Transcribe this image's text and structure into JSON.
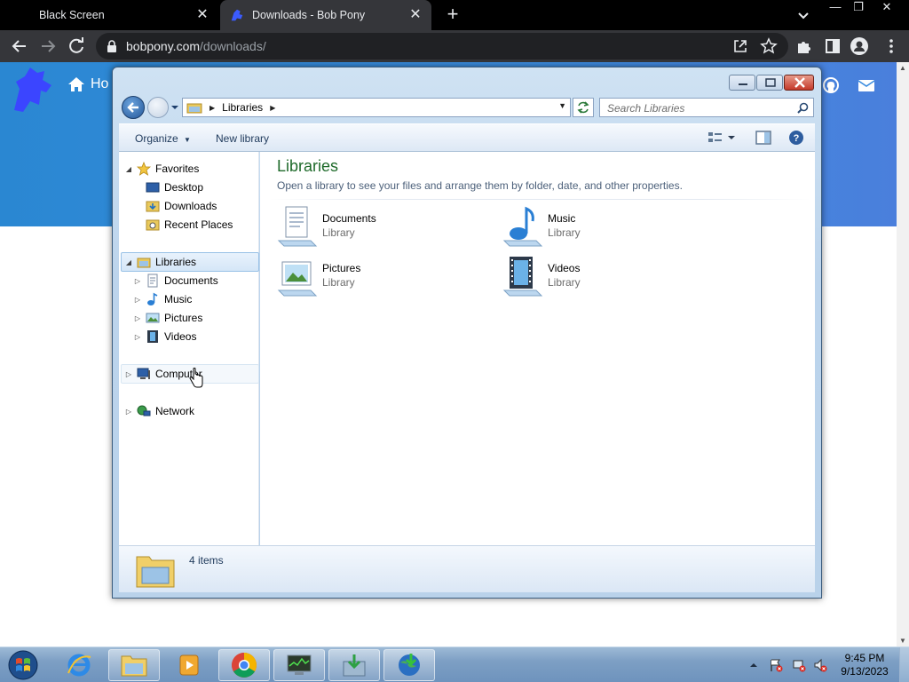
{
  "browser": {
    "tabs": [
      {
        "title": "Black Screen",
        "active": false
      },
      {
        "title": "Downloads - Bob Pony",
        "active": true
      }
    ],
    "url": {
      "host": "bobpony.com",
      "path": "/downloads/"
    }
  },
  "website": {
    "nav_home_label": "Ho"
  },
  "explorer": {
    "address": {
      "root": "Libraries"
    },
    "search_placeholder": "Search Libraries",
    "commands": {
      "organize": "Organize",
      "new_library": "New library"
    },
    "nav": {
      "favorites": {
        "label": "Favorites",
        "items": [
          "Desktop",
          "Downloads",
          "Recent Places"
        ]
      },
      "libraries": {
        "label": "Libraries",
        "items": [
          "Documents",
          "Music",
          "Pictures",
          "Videos"
        ]
      },
      "computer": "Computer",
      "network": "Network"
    },
    "content": {
      "title": "Libraries",
      "subtitle": "Open a library to see your files and arrange them by folder, date, and other properties.",
      "libraries": [
        {
          "name": "Documents",
          "type": "Library",
          "icon": "documents-library-icon"
        },
        {
          "name": "Music",
          "type": "Library",
          "icon": "music-library-icon"
        },
        {
          "name": "Pictures",
          "type": "Library",
          "icon": "pictures-library-icon"
        },
        {
          "name": "Videos",
          "type": "Library",
          "icon": "videos-library-icon"
        }
      ]
    },
    "details": {
      "item_count": "4 items"
    }
  },
  "taskbar": {
    "apps": [
      "internet-explorer",
      "windows-explorer",
      "media-player",
      "chrome",
      "task-manager",
      "installer",
      "download-manager"
    ],
    "clock": {
      "time": "9:45 PM",
      "date": "9/13/2023"
    }
  },
  "colors": {
    "chrome_bg": "#35363a",
    "banner": "#3c8de0",
    "library_title": "#1e6a2a"
  }
}
